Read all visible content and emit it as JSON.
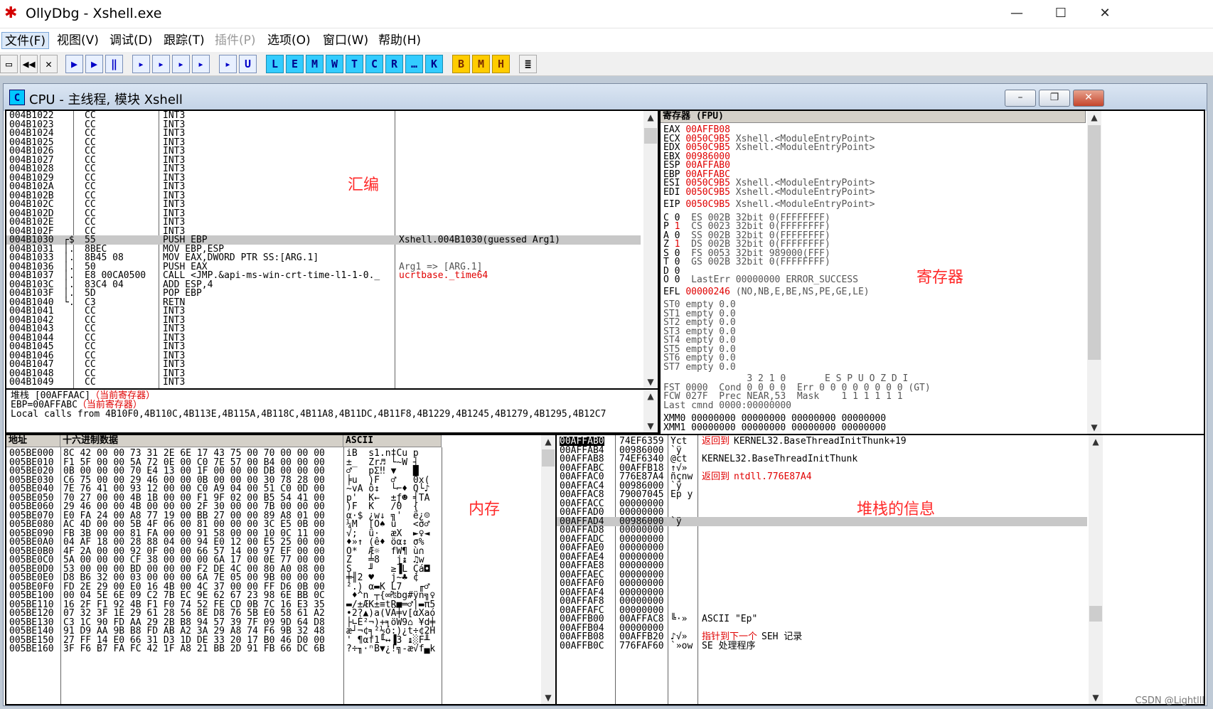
{
  "window": {
    "title": "OllyDbg - Xshell.exe",
    "min_label": "—",
    "max_label": "☐",
    "close_label": "✕"
  },
  "menu": [
    "文件(F)",
    "视图(V)",
    "调试(D)",
    "跟踪(T)",
    "插件(P)",
    "选项(O)",
    "窗口(W)",
    "帮助(H)"
  ],
  "toolbar": {
    "buttons": [
      "▶",
      "▶",
      "‖",
      "▸",
      "▸",
      "▸",
      "▸",
      "▸",
      "U",
      "L",
      "E",
      "M",
      "W",
      "T",
      "C",
      "R",
      "…",
      "K",
      "B",
      "M",
      "H",
      "≣"
    ]
  },
  "cpu": {
    "title": "CPU - 主线程, 模块 Xshell",
    "min_label": "–",
    "restore_label": "❐",
    "close_label": "✕"
  },
  "disasm": {
    "rows": [
      [
        "004B1022",
        "CC",
        "INT3",
        ""
      ],
      [
        "004B1023",
        "CC",
        "INT3",
        ""
      ],
      [
        "004B1024",
        "CC",
        "INT3",
        ""
      ],
      [
        "004B1025",
        "CC",
        "INT3",
        ""
      ],
      [
        "004B1026",
        "CC",
        "INT3",
        ""
      ],
      [
        "004B1027",
        "CC",
        "INT3",
        ""
      ],
      [
        "004B1028",
        "CC",
        "INT3",
        ""
      ],
      [
        "004B1029",
        "CC",
        "INT3",
        ""
      ],
      [
        "004B102A",
        "CC",
        "INT3",
        ""
      ],
      [
        "004B102B",
        "CC",
        "INT3",
        ""
      ],
      [
        "004B102C",
        "CC",
        "INT3",
        ""
      ],
      [
        "004B102D",
        "CC",
        "INT3",
        ""
      ],
      [
        "004B102E",
        "CC",
        "INT3",
        ""
      ],
      [
        "004B102F",
        "CC",
        "INT3",
        ""
      ],
      [
        "004B1030",
        "55",
        "PUSH EBP",
        "Xshell.004B1030(guessed Arg1)"
      ],
      [
        "004B1031",
        "8BEC",
        "MOV EBP,ESP",
        ""
      ],
      [
        "004B1033",
        "8B45 08",
        "MOV EAX,DWORD PTR SS:[ARG.1]",
        ""
      ],
      [
        "004B1036",
        "50",
        "PUSH EAX",
        "Arg1 => [ARG.1]"
      ],
      [
        "004B1037",
        "E8 00CA0500",
        "CALL <JMP.&api-ms-win-crt-time-l1-1-0._",
        "ucrtbase._time64"
      ],
      [
        "004B103C",
        "83C4 04",
        "ADD ESP,4",
        ""
      ],
      [
        "004B103F",
        "5D",
        "POP EBP",
        ""
      ],
      [
        "004B1040",
        "C3",
        "RETN",
        ""
      ],
      [
        "004B1041",
        "CC",
        "INT3",
        ""
      ],
      [
        "004B1042",
        "CC",
        "INT3",
        ""
      ],
      [
        "004B1043",
        "CC",
        "INT3",
        ""
      ],
      [
        "004B1044",
        "CC",
        "INT3",
        ""
      ],
      [
        "004B1045",
        "CC",
        "INT3",
        ""
      ],
      [
        "004B1046",
        "CC",
        "INT3",
        ""
      ],
      [
        "004B1047",
        "CC",
        "INT3",
        ""
      ],
      [
        "004B1048",
        "CC",
        "INT3",
        ""
      ],
      [
        "004B1049",
        "CC",
        "INT3",
        ""
      ]
    ],
    "jump_marks": {
      "004B1030": "┌$",
      "004B1031": "│.",
      "004B1033": "│.",
      "004B1036": "│.",
      "004B1037": "│.",
      "004B103C": "│.",
      "004B103F": "│.",
      "004B1040": "└."
    },
    "label": "汇编"
  },
  "info": {
    "line1_prefix": "堆栈 [00AFFAAC]",
    "line1_tag": "（当前寄存器）",
    "line2_prefix": "EBP=00AFFABC",
    "line2_tag": "（当前寄存器）",
    "line3": "Local calls from 4B10F0,4B110C,4B113E,4B115A,4B118C,4B11A8,4B11DC,4B11F8,4B1229,4B1245,4B1279,4B1295,4B12C7"
  },
  "registers": {
    "header": "寄存器 (FPU)",
    "label": "寄存器",
    "general": [
      [
        "EAX",
        "00AFFB08",
        ""
      ],
      [
        "ECX",
        "0050C9B5",
        "Xshell.<ModuleEntryPoint>"
      ],
      [
        "EDX",
        "0050C9B5",
        "Xshell.<ModuleEntryPoint>"
      ],
      [
        "EBX",
        "00986000",
        ""
      ],
      [
        "ESP",
        "00AFFAB0",
        ""
      ],
      [
        "EBP",
        "00AFFABC",
        ""
      ],
      [
        "ESI",
        "0050C9B5",
        "Xshell.<ModuleEntryPoint>"
      ],
      [
        "EDI",
        "0050C9B5",
        "Xshell.<ModuleEntryPoint>"
      ]
    ],
    "eip": [
      "EIP",
      "0050C9B5",
      "Xshell.<ModuleEntryPoint>"
    ],
    "flags": [
      [
        "C 0",
        "ES 002B 32bit 0(FFFFFFFF)"
      ],
      [
        "P 1",
        "CS 0023 32bit 0(FFFFFFFF)"
      ],
      [
        "A 0",
        "SS 002B 32bit 0(FFFFFFFF)"
      ],
      [
        "Z 1",
        "DS 002B 32bit 0(FFFFFFFF)"
      ],
      [
        "S 0",
        "FS 0053 32bit 989000(FFF)"
      ],
      [
        "T 0",
        "GS 002B 32bit 0(FFFFFFFF)"
      ],
      [
        "D 0",
        ""
      ],
      [
        "O 0",
        "LastErr 00000000 ERROR_SUCCESS"
      ]
    ],
    "efl": [
      "EFL",
      "00000246",
      "(NO,NB,E,BE,NS,PE,GE,LE)"
    ],
    "st": [
      "ST0 empty 0.0",
      "ST1 empty 0.0",
      "ST2 empty 0.0",
      "ST3 empty 0.0",
      "ST4 empty 0.0",
      "ST5 empty 0.0",
      "ST6 empty 0.0",
      "ST7 empty 0.0"
    ],
    "fpu": [
      "               3 2 1 0       E S P U O Z D I",
      "FST 0000  Cond 0 0 0 0  Err 0 0 0 0 0 0 0 0 (GT)",
      "FCW 027F  Prec NEAR,53  Mask    1 1 1 1 1 1",
      "Last cmnd 0000:00000000"
    ],
    "xmm": [
      "XMM0 00000000 00000000 00000000 00000000",
      "XMM1 00000000 00000000 00000000 00000000"
    ]
  },
  "dump": {
    "headers": [
      "地址",
      "十六进制数据",
      "ASCII"
    ],
    "label": "内存",
    "rows": [
      [
        "005BE000",
        "8C 42 00 00 73 31 2E 6E 17 43 75 00 70 00 00 00",
        "iB  s1.n‡Cu p"
      ],
      [
        "005BE010",
        "F1 5F 00 00 5A 72 0E 00 C0 7E 57 00 B4 00 00 00",
        "±_  Zr♬ └~W ┤"
      ],
      [
        "005BE020",
        "0B 00 00 00 70 E4 13 00 1F 00 00 00 DB 00 00 00",
        "♂   pΣ‼ ▼   █"
      ],
      [
        "005BE030",
        "C6 75 00 00 29 46 00 00 0B 00 00 00 30 78 28 00",
        "╞u  )F  ♂   0x("
      ],
      [
        "005BE040",
        "7E 76 41 00 93 12 00 00 C0 A9 04 00 51 C0 0D 00",
        "~vA ô↕  └⌐♦ Q└♪"
      ],
      [
        "005BE050",
        "70 27 00 00 4B 1B 00 00 F1 9F 02 00 B5 54 41 00",
        "p'  K←  ±ƒ☻ ╡TA"
      ],
      [
        "005BE060",
        "29 46 00 00 4B 00 00 00 2F 30 00 00 7B 00 00 00",
        ")F  K   /0  {"
      ],
      [
        "005BE070",
        "E0 FA 24 00 A8 77 19 00 BB 27 00 00 89 A8 01 00",
        "α·$ ¿w↓ ╗'  ë¿☺"
      ],
      [
        "005BE080",
        "AC 4D 00 00 5B 4F 06 00 81 00 00 00 3C E5 0B 00",
        "¼M  [O♠ ü   <σ♂"
      ],
      [
        "005BE090",
        "FB 3B 00 00 81 FA 00 00 91 58 00 00 10 0C 11 00",
        "√;  ü·  æX  ►♀◄"
      ],
      [
        "005BE0A0",
        "04 AF 18 00 28 88 04 00 94 E0 12 00 E5 25 00 00",
        "♦»↑ (ê♦ öα↕ σ%"
      ],
      [
        "005BE0B0",
        "4F 2A 00 00 92 0F 00 00 66 57 14 00 97 EF 00 00",
        "O*  Æ☼  fW¶ ù∩"
      ],
      [
        "005BE0C0",
        "5A 00 00 00 CF 38 00 00 00 6A 17 00 0E 77 00 00",
        "Z   ╧8   j↨ ♫w"
      ],
      [
        "005BE0D0",
        "53 00 00 00 BD 00 00 00 F2 DE 4C 00 80 A0 08 00",
        "S   ╜   ≥▐L Çá◘"
      ],
      [
        "005BE0E0",
        "D8 B6 32 00 03 00 00 00 6A 7E 05 00 9B 00 00 00",
        "╪╢2 ♥   j~♣ ¢"
      ],
      [
        "005BE0F0",
        "FD 2E 29 00 E0 16 4B 00 4C 37 00 00 FF D6 0B 00",
        "².) α▬K L7   ╓♂"
      ],
      [
        "005BE100",
        "00 04 5E 6E 09 C2 7B EC 9E 62 67 23 98 6E BB 0C",
        " ♦^n ┬{∞₧bg#ÿn╗♀"
      ],
      [
        "005BE110",
        "16 2F F1 92 4B F1 F0 74 52 FE CD 0B 7C 16 E3 35",
        "▬/±ÆK±≡tR■═♂|▬π5"
      ],
      [
        "005BE120",
        "07 32 3F 1E 29 61 28 56 8E D8 76 5B E0 58 61 A2",
        "•2?▲)a(VÄ╪v[αXaó"
      ],
      [
        "005BE130",
        "C3 1C 90 FD AA 29 2B B8 94 57 39 7F 09 9D 64 D8",
        "├∟É²¬)+╕öW9⌂ ¥d╪"
      ],
      [
        "005BE140",
        "91 D9 AA 9B B8 FD AB A2 3A 29 A8 74 F6 9B 32 48",
        "æ┘¬¢╕²½ó:)¿t÷¢2H"
      ],
      [
        "005BE150",
        "27 FF 14 E0 66 31 D3 1D DE 33 20 17 B0 46 D0 00",
        "' ¶αf1╙↔▐3 ↨░F╨"
      ],
      [
        "005BE160",
        "3F F6 B7 FA FC 42 1F A8 21 BB 2D 91 FB 66 DC 6B",
        "?÷╖·ⁿB▼¿!╗-æ√f▄k"
      ]
    ]
  },
  "stack": {
    "label": "堆栈的信息",
    "rows": [
      [
        "00AFFAB0",
        "74EF6359",
        "Yct",
        "返回到",
        "KERNEL32.BaseThreadInitThunk+19"
      ],
      [
        "00AFFAB4",
        "00986000",
        "`ÿ",
        "",
        ""
      ],
      [
        "00AFFAB8",
        "74EF6340",
        "@ct",
        "",
        "KERNEL32.BaseThreadInitThunk"
      ],
      [
        "00AFFABC",
        "00AFFB18",
        "↑√»",
        "",
        ""
      ],
      [
        "00AFFAC0",
        "776E87A4",
        "ñçnw",
        "返回到",
        "ntdll.776E87A4"
      ],
      [
        "00AFFAC4",
        "00986000",
        "`ÿ",
        "",
        ""
      ],
      [
        "00AFFAC8",
        "79007045",
        "Ep y",
        "",
        ""
      ],
      [
        "00AFFACC",
        "00000000",
        "",
        "",
        ""
      ],
      [
        "00AFFAD0",
        "00000000",
        "",
        "",
        ""
      ],
      [
        "00AFFAD4",
        "00986000",
        "`ÿ",
        "",
        ""
      ],
      [
        "00AFFAD8",
        "00000000",
        "",
        "",
        ""
      ],
      [
        "00AFFADC",
        "00000000",
        "",
        "",
        ""
      ],
      [
        "00AFFAE0",
        "00000000",
        "",
        "",
        ""
      ],
      [
        "00AFFAE4",
        "00000000",
        "",
        "",
        ""
      ],
      [
        "00AFFAE8",
        "00000000",
        "",
        "",
        ""
      ],
      [
        "00AFFAEC",
        "00000000",
        "",
        "",
        ""
      ],
      [
        "00AFFAF0",
        "00000000",
        "",
        "",
        ""
      ],
      [
        "00AFFAF4",
        "00000000",
        "",
        "",
        ""
      ],
      [
        "00AFFAF8",
        "00000000",
        "",
        "",
        ""
      ],
      [
        "00AFFAFC",
        "00000000",
        "",
        "",
        ""
      ],
      [
        "00AFFB00",
        "00AFFAC8",
        "╚·»",
        "",
        "ASCII \"Ep\""
      ],
      [
        "00AFFB04",
        "00000000",
        "",
        "",
        ""
      ],
      [
        "00AFFB08",
        "00AFFB20",
        "♪√»",
        "指针到下一个",
        "SEH 记录"
      ],
      [
        "00AFFB0C",
        "776FAF60",
        "`»ow",
        "",
        "SE 处理程序"
      ]
    ]
  },
  "watermark": "CSDN @Lightlll",
  "colors": {
    "accent_red": "#e00000",
    "selection": "#c8c8c8",
    "cyan_button": "#33ccff",
    "gold_button": "#ffcc00"
  }
}
